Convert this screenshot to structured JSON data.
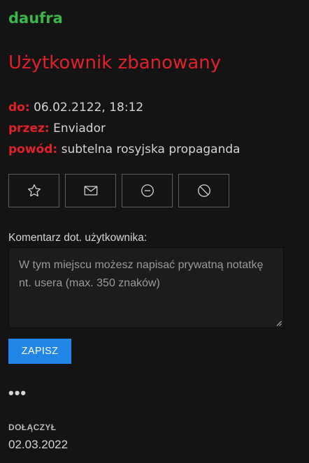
{
  "profile": {
    "username": "daufra",
    "ban_title": "Użytkownik zbanowany",
    "ban": {
      "until_label": "do:",
      "until_value": "06.02.2122, 18:12",
      "by_label": "przez:",
      "by_value": "Enviador",
      "reason_label": "powód:",
      "reason_value": "subtelna rosyjska propaganda"
    },
    "colors": {
      "username": "#3cb54a",
      "ban": "#e0202a",
      "accent": "#2285e8"
    }
  },
  "actions": [
    {
      "icon": "star-icon"
    },
    {
      "icon": "envelope-icon"
    },
    {
      "icon": "minus-circle-icon"
    },
    {
      "icon": "block-icon"
    }
  ],
  "comment": {
    "label": "Komentarz dot. użytkownika:",
    "placeholder": "W tym miejscu możesz napisać prywatną notatkę nt. usera (max. 350 znaków)",
    "value": "",
    "save_label": "ZAPISZ"
  },
  "more_label": "•••",
  "joined": {
    "label": "DOŁĄCZYŁ",
    "date": "02.03.2022"
  }
}
